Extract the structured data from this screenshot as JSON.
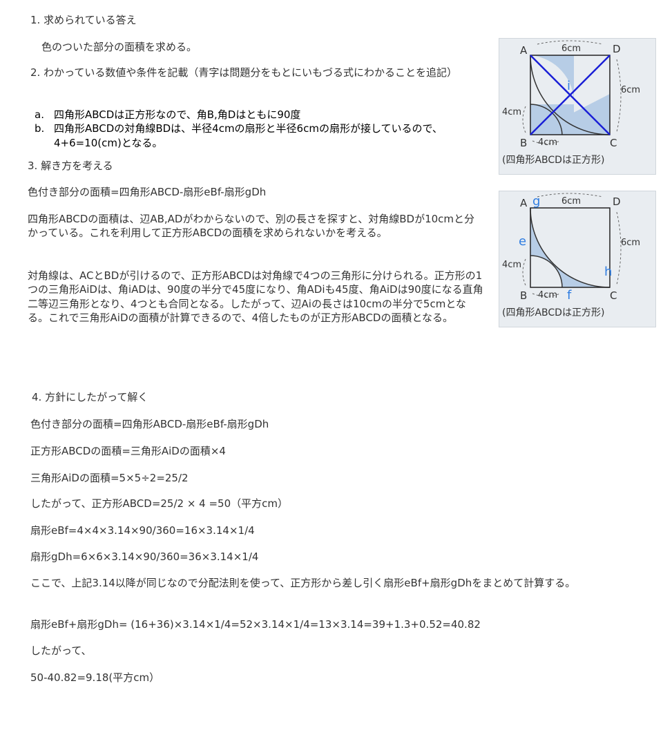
{
  "section1": {
    "heading": "1. 求められている答え",
    "body": "色のついた部分の面積を求める。"
  },
  "section2": {
    "heading": "2. わかっている数値や条件を記載（青字は問題分をもとにいもづる式にわかることを追記）",
    "items": [
      {
        "marker": "a.",
        "text": "四角形ABCDは正方形なので、角B,角Dはともに90度"
      },
      {
        "marker": "b.",
        "text": "四角形ABCDの対角線BDは、半径4cmの扇形と半径6cmの扇形が接しているので、4+6=10(cm)となる。"
      }
    ]
  },
  "section3": {
    "heading": "3. 解き方を考える",
    "paragraphs": [
      "色付き部分の面積=四角形ABCD-扇形eBf-扇形gDh",
      "四角形ABCDの面積は、辺AB,ADがわからないので、別の長さを探すと、対角線BDが10cmと分かっている。これを利用して正方形ABCDの面積を求められないかを考える。",
      "対角線は、ACとBDが引けるので、正方形ABCDは対角線で4つの三角形に分けられる。正方形の1つの三角形AiDは、角iADは、90度の半分で45度になり、角ADiも45度、角AiDは90度になる直角二等辺三角形となり、4つとも合同となる。したがって、辺Aiの長さは10cmの半分で5cmとなる。これで三角形AiDの面積が計算できるので、4倍したものが正方形ABCDの面積となる。"
    ]
  },
  "section4": {
    "heading": "4. 方針にしたがって解く",
    "lines": [
      "色付き部分の面積=四角形ABCD-扇形eBf-扇形gDh",
      "正方形ABCDの面積=三角形AiDの面積×4",
      "三角形AiDの面積=5×5÷2=25/2",
      "したがって、正方形ABCD=25/2 × 4 =50（平方cm）",
      "扇形eBf=4×4×3.14×90/360=16×3.14×1/4",
      "扇形gDh=6×6×3.14×90/360=36×3.14×1/4",
      "ここで、上記3.14以降が同じなので分配法則を使って、正方形から差し引く扇形eBf+扇形gDhをまとめて計算する。",
      "扇形eBf+扇形gDh= (16+36)×3.14×1/4=52×3.14×1/4=13×3.14=39+1.3+0.52=40.82",
      "したがって、",
      "50-40.82=9.18(平方cm）"
    ]
  },
  "figure1": {
    "vertex_a": "A",
    "vertex_b": "B",
    "vertex_c": "C",
    "vertex_d": "D",
    "point_i": "i",
    "top_length": "6cm",
    "right_length": "6cm",
    "left_length": "4cm",
    "bottom_length": "4cm",
    "caption": "(四角形ABCDは正方形)"
  },
  "figure2": {
    "vertex_a": "A",
    "vertex_b": "B",
    "vertex_c": "C",
    "vertex_d": "D",
    "point_e": "e",
    "point_f": "f",
    "point_g": "g",
    "point_h": "h",
    "top_length": "6cm",
    "right_length": "6cm",
    "left_length": "4cm",
    "bottom_length": "4cm",
    "caption": "(四角形ABCDは正方形)"
  },
  "colors": {
    "text": "#333333",
    "annotation_blue": "#1a1fd6",
    "label_blue": "#2f7de1",
    "shade": "#b7cde6",
    "photo_bg": "#e9edf1"
  }
}
